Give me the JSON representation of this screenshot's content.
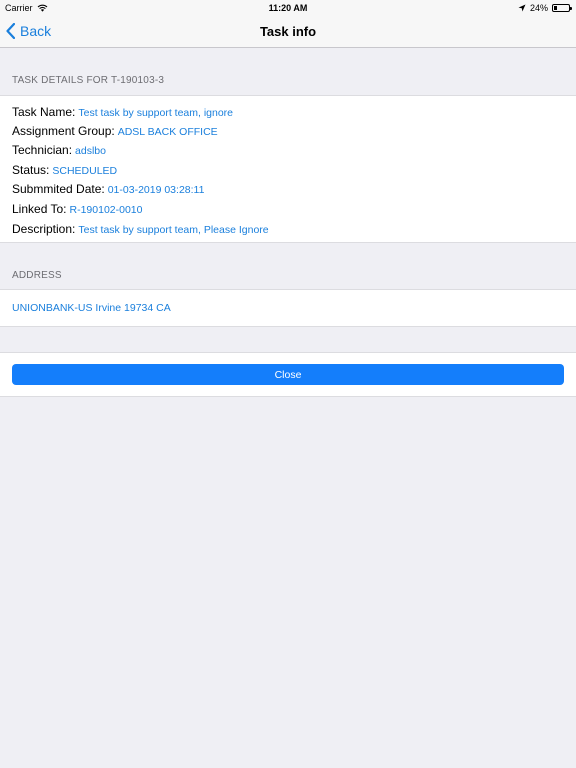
{
  "status_bar": {
    "carrier": "Carrier",
    "time": "11:20 AM",
    "battery_text": "24%",
    "battery_level": 0.24
  },
  "nav": {
    "back_label": "Back",
    "title": "Task info"
  },
  "task_details": {
    "header": "TASK DETAILS FOR T-190103-3",
    "rows": [
      {
        "label": "Task Name:",
        "value": "Test task by support team, ignore"
      },
      {
        "label": "Assignment Group:",
        "value": "ADSL BACK OFFICE"
      },
      {
        "label": "Technician:",
        "value": "adslbo"
      },
      {
        "label": "Status:",
        "value": "SCHEDULED"
      },
      {
        "label": "Submmited Date:",
        "value": "01-03-2019 03:28:11"
      },
      {
        "label": "Linked To:",
        "value": "R-190102-0010"
      },
      {
        "label": "Description:",
        "value": "Test task by support team, Please Ignore"
      }
    ]
  },
  "address": {
    "header": "ADDRESS",
    "text": "UNIONBANK-US Irvine 19734 CA"
  },
  "actions": {
    "close_label": "Close"
  },
  "colors": {
    "accent": "#1a7fdc",
    "button": "#147efb",
    "background": "#efeff4"
  }
}
